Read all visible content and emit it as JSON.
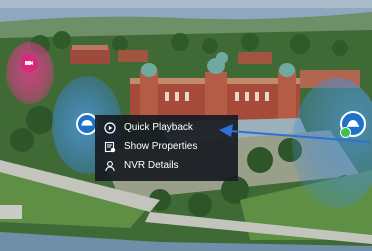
{
  "map_view": {
    "colors": {
      "water": "#8fa8bf",
      "lawn": "#5f8f45",
      "building_brick": "#a64a3a",
      "roof_dome": "#6fa9a0",
      "camera_blue": "#1e73c8",
      "camera_pink": "#d9277f",
      "status_online": "#3ac24a",
      "annotation_arrow": "#2f6fd6"
    }
  },
  "cameras": [
    {
      "id": "camera-left",
      "icon": "dome-camera-icon",
      "color": "#1e73c8"
    },
    {
      "id": "camera-right",
      "icon": "dome-camera-icon",
      "color": "#1e73c8",
      "status": "online"
    },
    {
      "id": "camera-pink",
      "icon": "camera-icon",
      "color": "#d9277f"
    }
  ],
  "context_menu": {
    "items": [
      {
        "label": "Quick Playback",
        "icon": "play-circle-icon"
      },
      {
        "label": "Show Properties",
        "icon": "properties-icon"
      },
      {
        "label": "NVR Details",
        "icon": "user-icon"
      }
    ]
  }
}
